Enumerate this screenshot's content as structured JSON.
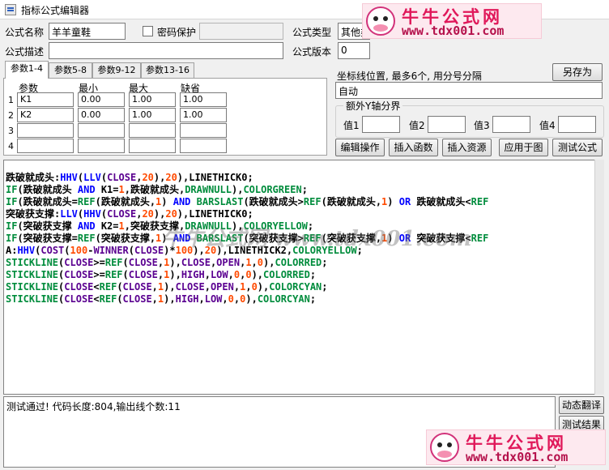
{
  "window": {
    "title": "指标公式编辑器"
  },
  "form": {
    "name_label": "公式名称",
    "name_value": "羊羊童鞋",
    "password_label": "密码保护",
    "type_label": "公式类型",
    "type_value": "其他类",
    "desc_label": "公式描述",
    "desc_value": "",
    "version_label": "公式版本",
    "version_value": "0"
  },
  "tabs": [
    "参数1-4",
    "参数5-8",
    "参数9-12",
    "参数13-16"
  ],
  "params": {
    "headers": [
      "参数",
      "最小",
      "最大",
      "缺省"
    ],
    "rows": [
      {
        "num": "1",
        "name": "K1",
        "min": "0.00",
        "max": "1.00",
        "def": "1.00"
      },
      {
        "num": "2",
        "name": "K2",
        "min": "0.00",
        "max": "1.00",
        "def": "1.00"
      },
      {
        "num": "3",
        "name": "",
        "min": "",
        "max": "",
        "def": ""
      },
      {
        "num": "4",
        "name": "",
        "min": "",
        "max": "",
        "def": ""
      }
    ]
  },
  "axis": {
    "label": "坐标线位置, 最多6个, 用分号分隔",
    "value": "自动",
    "group_label": "额外Y轴分界",
    "values": [
      {
        "label": "值1",
        "value": ""
      },
      {
        "label": "值2",
        "value": ""
      },
      {
        "label": "值3",
        "value": ""
      },
      {
        "label": "值4",
        "value": ""
      }
    ]
  },
  "buttons": {
    "save_as": "另存为",
    "edit_ops": "编辑操作",
    "insert_func": "插入函数",
    "insert_res": "插入资源",
    "apply_chart": "应用于图",
    "test_formula": "测试公式",
    "dyn_translate": "动态翻译",
    "test_result": "测试结果"
  },
  "code": [
    [
      [
        "跌破就成头:",
        "b"
      ],
      [
        "HHV",
        "k"
      ],
      [
        "(",
        "b"
      ],
      [
        "LLV",
        "k"
      ],
      [
        "(",
        "b"
      ],
      [
        "CLOSE",
        "o"
      ],
      [
        ",",
        "b"
      ],
      [
        "20",
        "n"
      ],
      [
        "),",
        "b"
      ],
      [
        "20",
        "n"
      ],
      [
        "),LINETHICK0;",
        "b"
      ]
    ],
    [
      [
        "IF",
        "c"
      ],
      [
        "(跌破就成头 ",
        "b"
      ],
      [
        "AND",
        "k"
      ],
      [
        " K1=",
        "b"
      ],
      [
        "1",
        "n"
      ],
      [
        ",跌破就成头,",
        "b"
      ],
      [
        "DRAWNULL",
        "c"
      ],
      [
        "),",
        "b"
      ],
      [
        "COLORGREEN",
        "c"
      ],
      [
        ";",
        "b"
      ]
    ],
    [
      [
        "IF",
        "c"
      ],
      [
        "(跌破就成头=",
        "b"
      ],
      [
        "REF",
        "c"
      ],
      [
        "(跌破就成头,",
        "b"
      ],
      [
        "1",
        "n"
      ],
      [
        ") ",
        "b"
      ],
      [
        "AND",
        "k"
      ],
      [
        " ",
        "b"
      ],
      [
        "BARSLAST",
        "c"
      ],
      [
        "(跌破就成头>",
        "b"
      ],
      [
        "REF",
        "c"
      ],
      [
        "(跌破就成头,",
        "b"
      ],
      [
        "1",
        "n"
      ],
      [
        ") ",
        "b"
      ],
      [
        "OR",
        "k"
      ],
      [
        " 跌破就成头<",
        "b"
      ],
      [
        "REF",
        "c"
      ]
    ],
    [
      [
        "突破获支撑:",
        "b"
      ],
      [
        "LLV",
        "k"
      ],
      [
        "(",
        "b"
      ],
      [
        "HHV",
        "k"
      ],
      [
        "(",
        "b"
      ],
      [
        "CLOSE",
        "o"
      ],
      [
        ",",
        "b"
      ],
      [
        "20",
        "n"
      ],
      [
        "),",
        "b"
      ],
      [
        "20",
        "n"
      ],
      [
        "),LINETHICK0;",
        "b"
      ]
    ],
    [
      [
        "IF",
        "c"
      ],
      [
        "(突破获支撑 ",
        "b"
      ],
      [
        "AND",
        "k"
      ],
      [
        " K2=",
        "b"
      ],
      [
        "1",
        "n"
      ],
      [
        ",突破获支撑,",
        "b"
      ],
      [
        "DRAWNULL",
        "c"
      ],
      [
        "),",
        "b"
      ],
      [
        "COLORYELLOW",
        "c"
      ],
      [
        ";",
        "b"
      ]
    ],
    [
      [
        "IF",
        "c"
      ],
      [
        "(突破获支撑=",
        "b"
      ],
      [
        "REF",
        "c"
      ],
      [
        "(突破获支撑,",
        "b"
      ],
      [
        "1",
        "n"
      ],
      [
        ") ",
        "b"
      ],
      [
        "AND",
        "k"
      ],
      [
        " ",
        "b"
      ],
      [
        "BARSLAST",
        "c"
      ],
      [
        "(突破获支撑>",
        "b"
      ],
      [
        "REF",
        "c"
      ],
      [
        "(突破获支撑,",
        "b"
      ],
      [
        "1",
        "n"
      ],
      [
        ") ",
        "b"
      ],
      [
        "OR",
        "k"
      ],
      [
        " 突破获支撑<",
        "b"
      ],
      [
        "REF",
        "c"
      ]
    ],
    [
      [
        "A:",
        "b"
      ],
      [
        "HHV",
        "k"
      ],
      [
        "(",
        "b"
      ],
      [
        "COST",
        "o"
      ],
      [
        "(",
        "b"
      ],
      [
        "100",
        "n"
      ],
      [
        "-",
        "b"
      ],
      [
        "WINNER",
        "o"
      ],
      [
        "(",
        "b"
      ],
      [
        "CLOSE",
        "o"
      ],
      [
        ")*",
        "b"
      ],
      [
        "100",
        "n"
      ],
      [
        "),",
        "b"
      ],
      [
        "20",
        "n"
      ],
      [
        "),LINETHICK2,",
        "b"
      ],
      [
        "COLORYELLOW",
        "c"
      ],
      [
        ";",
        "b"
      ]
    ],
    [
      [
        "STICKLINE",
        "c"
      ],
      [
        "(",
        "b"
      ],
      [
        "CLOSE",
        "o"
      ],
      [
        ">=",
        "b"
      ],
      [
        "REF",
        "c"
      ],
      [
        "(",
        "b"
      ],
      [
        "CLOSE",
        "o"
      ],
      [
        ",",
        "b"
      ],
      [
        "1",
        "n"
      ],
      [
        "),",
        "b"
      ],
      [
        "CLOSE",
        "o"
      ],
      [
        ",",
        "b"
      ],
      [
        "OPEN",
        "o"
      ],
      [
        ",",
        "b"
      ],
      [
        "1",
        "n"
      ],
      [
        ",",
        "b"
      ],
      [
        "0",
        "n"
      ],
      [
        "),",
        "b"
      ],
      [
        "COLORRED",
        "c"
      ],
      [
        ";",
        "b"
      ]
    ],
    [
      [
        "STICKLINE",
        "c"
      ],
      [
        "(",
        "b"
      ],
      [
        "CLOSE",
        "o"
      ],
      [
        ">=",
        "b"
      ],
      [
        "REF",
        "c"
      ],
      [
        "(",
        "b"
      ],
      [
        "CLOSE",
        "o"
      ],
      [
        ",",
        "b"
      ],
      [
        "1",
        "n"
      ],
      [
        "),",
        "b"
      ],
      [
        "HIGH",
        "o"
      ],
      [
        ",",
        "b"
      ],
      [
        "LOW",
        "o"
      ],
      [
        ",",
        "b"
      ],
      [
        "0",
        "n"
      ],
      [
        ",",
        "b"
      ],
      [
        "0",
        "n"
      ],
      [
        "),",
        "b"
      ],
      [
        "COLORRED",
        "c"
      ],
      [
        ";",
        "b"
      ]
    ],
    [
      [
        "STICKLINE",
        "c"
      ],
      [
        "(",
        "b"
      ],
      [
        "CLOSE",
        "o"
      ],
      [
        "<",
        "b"
      ],
      [
        "REF",
        "c"
      ],
      [
        "(",
        "b"
      ],
      [
        "CLOSE",
        "o"
      ],
      [
        ",",
        "b"
      ],
      [
        "1",
        "n"
      ],
      [
        "),",
        "b"
      ],
      [
        "CLOSE",
        "o"
      ],
      [
        ",",
        "b"
      ],
      [
        "OPEN",
        "o"
      ],
      [
        ",",
        "b"
      ],
      [
        "1",
        "n"
      ],
      [
        ",",
        "b"
      ],
      [
        "0",
        "n"
      ],
      [
        "),",
        "b"
      ],
      [
        "COLORCYAN",
        "c"
      ],
      [
        ";",
        "b"
      ]
    ],
    [
      [
        "STICKLINE",
        "c"
      ],
      [
        "(",
        "b"
      ],
      [
        "CLOSE",
        "o"
      ],
      [
        "<",
        "b"
      ],
      [
        "REF",
        "c"
      ],
      [
        "(",
        "b"
      ],
      [
        "CLOSE",
        "o"
      ],
      [
        ",",
        "b"
      ],
      [
        "1",
        "n"
      ],
      [
        "),",
        "b"
      ],
      [
        "HIGH",
        "o"
      ],
      [
        ",",
        "b"
      ],
      [
        "LOW",
        "o"
      ],
      [
        ",",
        "b"
      ],
      [
        "0",
        "n"
      ],
      [
        ",",
        "b"
      ],
      [
        "0",
        "n"
      ],
      [
        "),",
        "b"
      ],
      [
        "COLORCYAN",
        "c"
      ],
      [
        ";",
        "b"
      ]
    ]
  ],
  "status": {
    "message": "测试通过! 代码长度:804,输出线个数:11"
  },
  "watermark": {
    "brand": "牛牛公式网",
    "url": "www.tdx001.com",
    "overlay": "牛牛公式网  www.tdx001.com"
  }
}
